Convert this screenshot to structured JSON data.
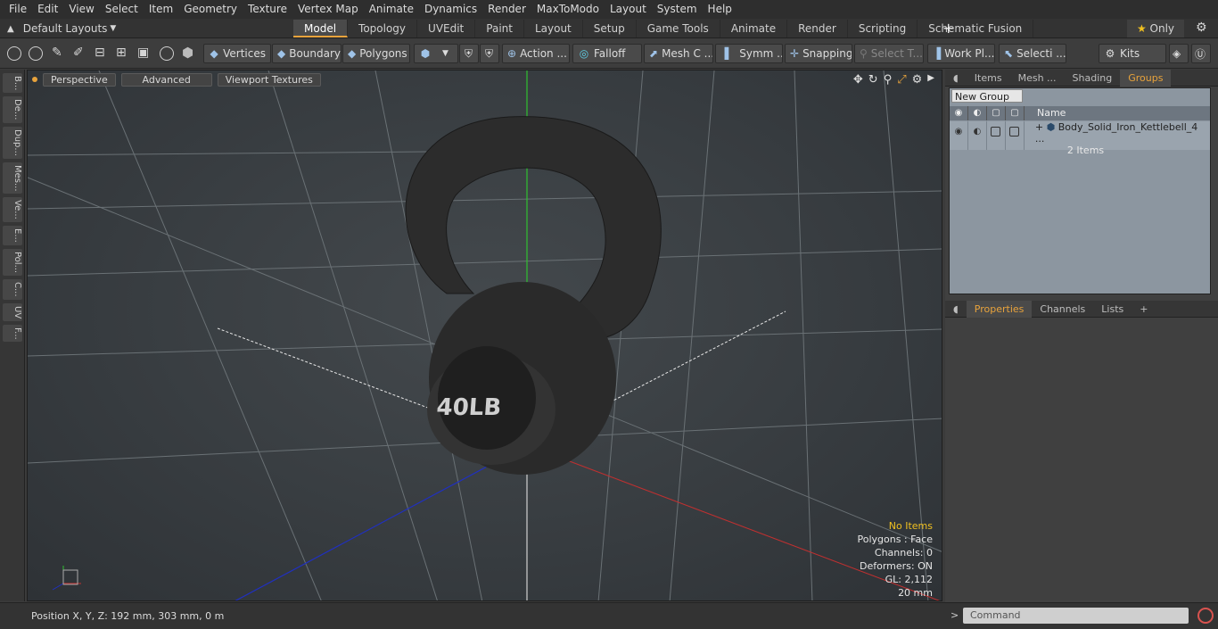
{
  "menu": [
    "File",
    "Edit",
    "View",
    "Select",
    "Item",
    "Geometry",
    "Texture",
    "Vertex Map",
    "Animate",
    "Dynamics",
    "Render",
    "MaxToModo",
    "Layout",
    "System",
    "Help"
  ],
  "layouts": {
    "label": "Default Layouts"
  },
  "tabs": [
    "Model",
    "Topology",
    "UVEdit",
    "Paint",
    "Layout",
    "Setup",
    "Game Tools",
    "Animate",
    "Render",
    "Scripting",
    "Schematic Fusion"
  ],
  "only_label": "Only",
  "toolbar": {
    "vertices": "Vertices",
    "boundary": "Boundary",
    "polygons": "Polygons",
    "action": "Action ...",
    "falloff": "Falloff",
    "meshc": "Mesh C ...",
    "symm": "Symm ...",
    "snapping": "Snapping",
    "selectt": "Select T...",
    "workpl": "Work Pl...",
    "selecti": "Selecti ...",
    "kits": "Kits"
  },
  "lefttabs": [
    "B...",
    "De...",
    "Dup...",
    "Mes...",
    "Ve...",
    "E...",
    "Pol...",
    "C...",
    "UV",
    "F..."
  ],
  "viewport": {
    "perspective": "Perspective",
    "advanced": "Advanced",
    "textures": "Viewport Textures"
  },
  "stats": {
    "items": "No Items",
    "polygons": "Polygons : Face",
    "channels": "Channels: 0",
    "deformers": "Deformers: ON",
    "gl": "GL: 2,112",
    "scale": "20 mm"
  },
  "statusbar": {
    "position": "Position X, Y, Z:   192 mm, 303 mm, 0 m"
  },
  "panel_tabs": [
    "Items",
    "Mesh ...",
    "Shading",
    "Groups"
  ],
  "groups": {
    "new_group": "New Group",
    "name_header": "Name",
    "item_name": "Body_Solid_Iron_Kettlebell_4 ...",
    "item_count": "2 Items"
  },
  "bottom_tabs": [
    "Properties",
    "Channels",
    "Lists"
  ],
  "command": {
    "placeholder": "Command"
  },
  "kettlebell_label": "40LB",
  "colors": {
    "accent": "#e8a33c",
    "x_axis": "#c03030",
    "y_axis": "#30c030",
    "z_axis": "#2030c0"
  }
}
